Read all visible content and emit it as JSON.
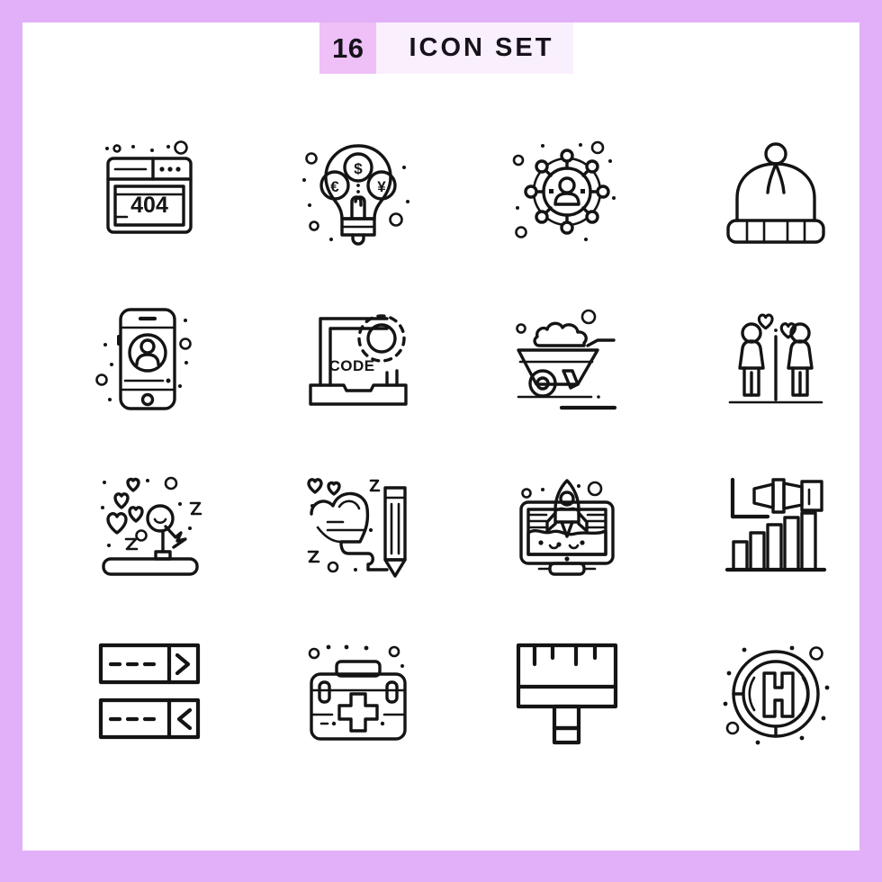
{
  "page": {
    "background_color": "#e2b0f8",
    "canvas_color": "#ffffff",
    "stroke_color": "#141414"
  },
  "header": {
    "count": "16",
    "title": "ICON SET",
    "count_bg": "#eec0f7",
    "title_bg": "#faeffd"
  },
  "grid": {
    "columns": 4,
    "rows": 4,
    "total": 16
  },
  "icons": [
    {
      "index": 1,
      "name": "error-404-browser-icon",
      "label": "404",
      "row": 1,
      "col": 1
    },
    {
      "index": 2,
      "name": "currency-idea-bulb-icon",
      "label": "",
      "row": 1,
      "col": 2
    },
    {
      "index": 3,
      "name": "social-network-user-icon",
      "label": "",
      "row": 1,
      "col": 3
    },
    {
      "index": 4,
      "name": "winter-beanie-hat-icon",
      "label": "",
      "row": 1,
      "col": 4
    },
    {
      "index": 5,
      "name": "mobile-user-profile-icon",
      "label": "",
      "row": 2,
      "col": 1
    },
    {
      "index": 6,
      "name": "laptop-code-settings-icon",
      "label": "CODE",
      "row": 2,
      "col": 2
    },
    {
      "index": 7,
      "name": "wheelbarrow-soil-icon",
      "label": "",
      "row": 2,
      "col": 3
    },
    {
      "index": 8,
      "name": "long-distance-couple-icon",
      "label": "",
      "row": 2,
      "col": 4
    },
    {
      "index": 9,
      "name": "dreaming-love-sleep-icon",
      "label": "",
      "row": 3,
      "col": 1
    },
    {
      "index": 10,
      "name": "love-letter-pencil-icon",
      "label": "",
      "row": 3,
      "col": 2
    },
    {
      "index": 11,
      "name": "startup-rocket-monitor-icon",
      "label": "",
      "row": 3,
      "col": 3
    },
    {
      "index": 12,
      "name": "business-forecast-chart-icon",
      "label": "",
      "row": 3,
      "col": 4
    },
    {
      "index": 13,
      "name": "data-exchange-arrows-icon",
      "label": "",
      "row": 4,
      "col": 1
    },
    {
      "index": 14,
      "name": "first-aid-kit-icon",
      "label": "",
      "row": 4,
      "col": 2
    },
    {
      "index": 15,
      "name": "paint-scraper-ruler-icon",
      "label": "",
      "row": 4,
      "col": 3
    },
    {
      "index": 16,
      "name": "helipad-h-marker-icon",
      "label": "H",
      "row": 4,
      "col": 4
    }
  ]
}
